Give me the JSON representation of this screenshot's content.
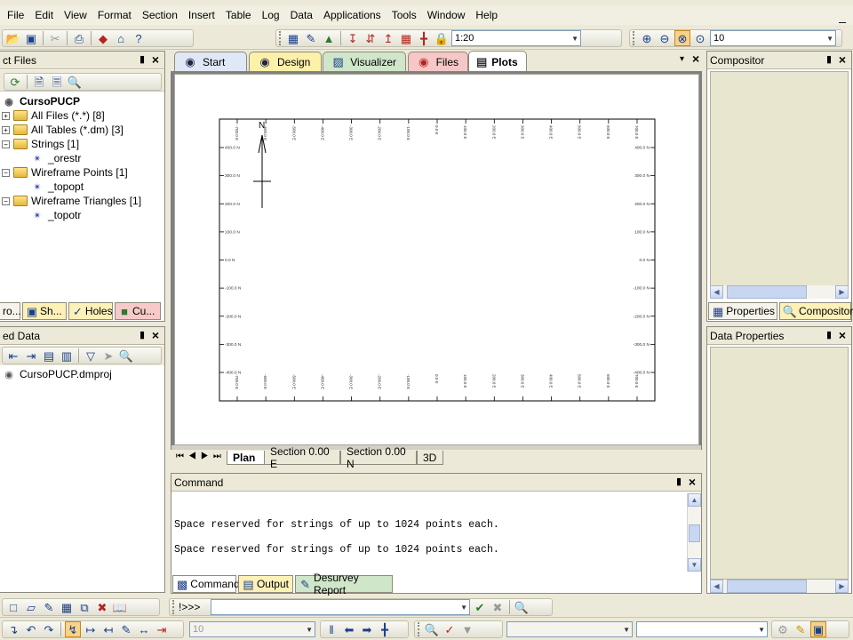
{
  "menu": [
    "File",
    "Edit",
    "View",
    "Format",
    "Section",
    "Insert",
    "Table",
    "Log",
    "Data",
    "Applications",
    "Tools",
    "Window",
    "Help"
  ],
  "toolbar": {
    "scale_value": "1:20",
    "zoom_value": "10"
  },
  "project_files": {
    "title": "ct Files",
    "root": "CursoPUCP",
    "items": [
      {
        "label": "All Files (*.*) [8]"
      },
      {
        "label": "All Tables (*.dm) [3]"
      },
      {
        "label": "Strings [1]"
      },
      {
        "label": "_orestr"
      },
      {
        "label": "Wireframe Points [1]"
      },
      {
        "label": "_topopt"
      },
      {
        "label": "Wireframe Triangles [1]"
      },
      {
        "label": "_topotr"
      }
    ],
    "bottom_tabs": [
      "ro...",
      "Sh...",
      "Holes",
      "Cu..."
    ]
  },
  "loaded_data": {
    "title": "ed Data",
    "items": [
      "CursoPUCP.dmproj"
    ]
  },
  "doc_tabs": [
    "Start",
    "Design",
    "Visualizer",
    "Files",
    "Plots"
  ],
  "plot": {
    "north_label": "N",
    "x_ticks": [
      "-700.0 E",
      "-600.0 E",
      "-500.0 E",
      "-400.0 E",
      "-300.0 E",
      "-200.0 E",
      "-100.0 E",
      "0.0 E",
      "100.0 E",
      "200.0 E",
      "300.0 E",
      "400.0 E",
      "500.0 E",
      "600.0 E",
      "700.0 E"
    ],
    "y_ticks": [
      "400.0 N",
      "300.0 N",
      "200.0 N",
      "100.0 N",
      "0.0 N",
      "-100.0 N",
      "-200.0 N",
      "-300.0 N",
      "-400.0 N"
    ]
  },
  "plot_tabs": [
    "Plan",
    "Section 0.00 E",
    "Section 0.00 N",
    "3D"
  ],
  "command": {
    "title": "Command",
    "lines": [
      "Space reserved for strings of up to 1024 points each.",
      "Space reserved for strings of up to 1024 points each."
    ],
    "tabs": [
      "Command",
      "Output",
      "Desurvey Report"
    ],
    "prompt": "!>>>"
  },
  "compositor": {
    "title": "Compositor",
    "tabs": [
      "Properties",
      "Compositor"
    ]
  },
  "data_properties": {
    "title": "Data Properties"
  },
  "bottom_toolbar": {
    "value": "10"
  }
}
